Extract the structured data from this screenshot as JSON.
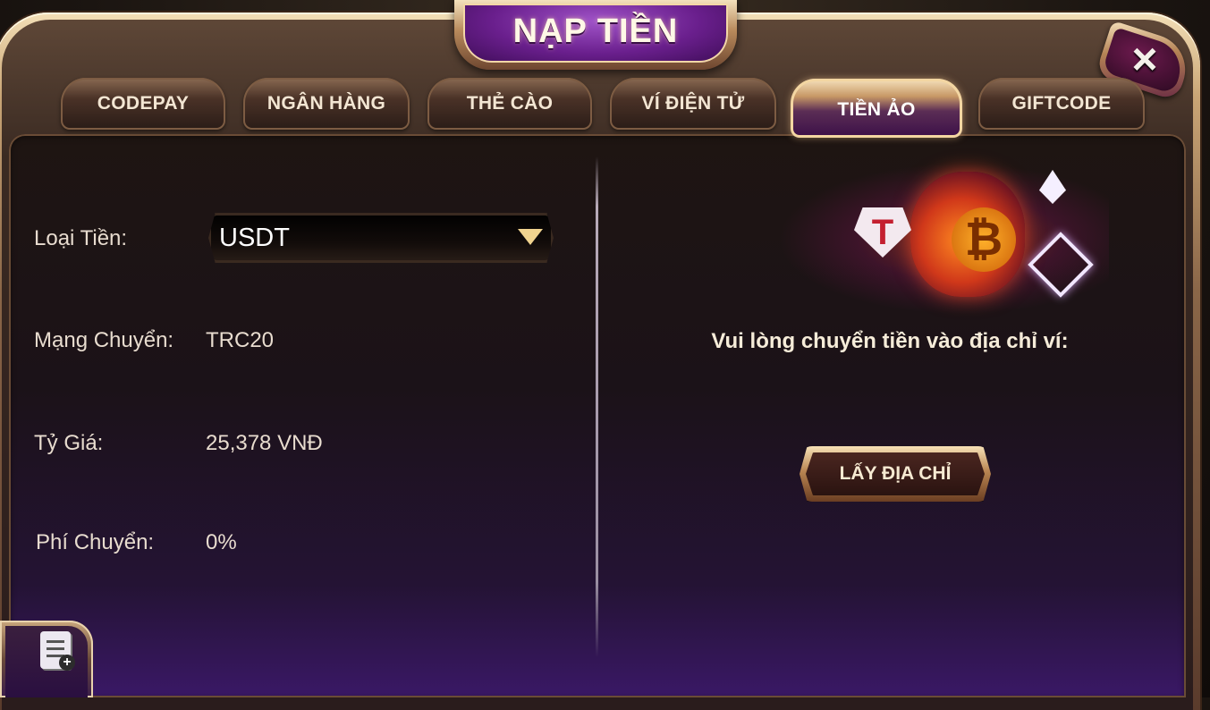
{
  "dialog": {
    "title": "NẠP TIỀN",
    "close_icon": "×"
  },
  "tabs": [
    {
      "label": "CODEPAY",
      "active": false
    },
    {
      "label": "NGÂN HÀNG",
      "active": false
    },
    {
      "label": "THẺ CÀO",
      "active": false
    },
    {
      "label": "VÍ ĐIỆN TỬ",
      "active": false
    },
    {
      "label": "TIỀN ẢO",
      "active": true
    },
    {
      "label": "GIFTCODE",
      "active": false
    }
  ],
  "form": {
    "currency_label": "Loại Tiền:",
    "currency_value": "USDT",
    "network_label": "Mạng Chuyển:",
    "network_value": "TRC20",
    "rate_label": "Tỷ Giá:",
    "rate_value": "25,378 VNĐ",
    "fee_label": "Phí Chuyển:",
    "fee_value": "0%"
  },
  "deposit": {
    "instruction": "Vui lòng chuyển tiền vào địa chỉ ví:",
    "get_address_label": "LẤY ĐỊA CHỈ",
    "art_icons": [
      "tether-icon",
      "bitcoin-icon",
      "binance-icon",
      "ethereum-icon"
    ],
    "tether_glyph": "T",
    "bitcoin_glyph": "₿"
  },
  "history": {
    "icon": "history-list-icon",
    "plus_glyph": "+"
  },
  "colors": {
    "gold": "#d9bf90",
    "purple": "#6a1f8d",
    "panel_bg": "#1b1218"
  }
}
